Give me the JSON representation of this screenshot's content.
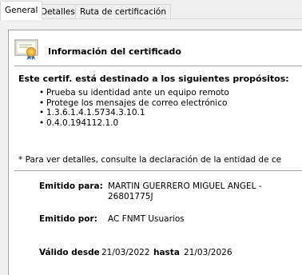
{
  "tabs": [
    "General",
    "Detalles",
    "Ruta de certificación"
  ],
  "header": {
    "icon": "certificate-icon",
    "title": "Información del certificado"
  },
  "purposes": {
    "heading": "Este certif. está destinado a los siguientes propósitos:",
    "items": [
      "Prueba su identidad ante un equipo remoto",
      "Protege los mensajes de correo electrónico",
      "1.3.6.1.4.1.5734.3.10.1",
      "0.4.0.194112.1.0"
    ]
  },
  "note": "* Para ver detalles, consulte la declaración de la entidad de ce",
  "issued_to": {
    "label": "Emitido para:",
    "value_line1": "MARTIN GUERRERO MIGUEL ANGEL -",
    "value_line2": "26801775J"
  },
  "issued_by": {
    "label": "Emitido por:",
    "value": "AC FNMT Usuarios"
  },
  "validity": {
    "from_label": "Válido desde",
    "from": "21/03/2022",
    "to_label": "hasta",
    "to": "21/03/2026"
  }
}
